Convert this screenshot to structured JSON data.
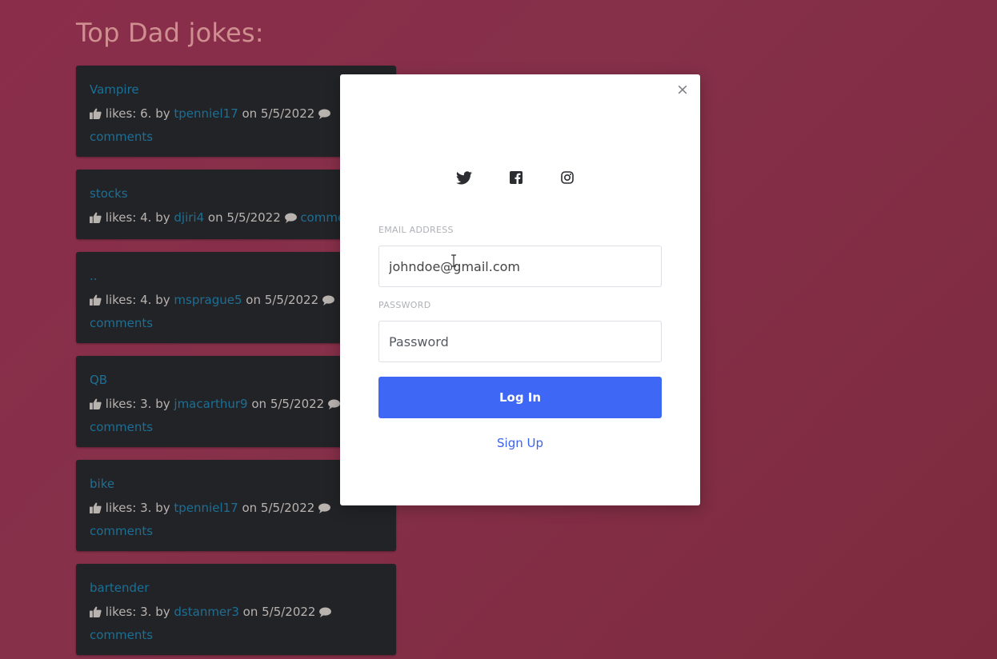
{
  "page": {
    "title": "Top Dad jokes:"
  },
  "jokes": [
    {
      "title": "Vampire",
      "likes_text": "likes: 6. by",
      "author": "tpenniel17",
      "date_text": "on 5/5/2022",
      "comments": "comments"
    },
    {
      "title": "stocks",
      "likes_text": "likes: 4. by",
      "author": "djiri4",
      "date_text": "on 5/5/2022",
      "comments": "comments"
    },
    {
      "title": "..",
      "likes_text": "likes: 4. by",
      "author": "msprague5",
      "date_text": "on 5/5/2022",
      "comments": "comments"
    },
    {
      "title": "QB",
      "likes_text": "likes: 3. by",
      "author": "jmacarthur9",
      "date_text": "on 5/5/2022",
      "comments": "comments"
    },
    {
      "title": "bike",
      "likes_text": "likes: 3. by",
      "author": "tpenniel17",
      "date_text": "on 5/5/2022",
      "comments": "comments"
    },
    {
      "title": "bartender",
      "likes_text": "likes: 3. by",
      "author": "dstanmer3",
      "date_text": "on 5/5/2022",
      "comments": "comments"
    }
  ],
  "modal": {
    "close_glyph": "×",
    "social_icons": [
      "twitter-icon",
      "facebook-icon",
      "instagram-icon"
    ],
    "email_label": "EMAIL ADDRESS",
    "email_value": "johndoe@gmail.com",
    "password_label": "PASSWORD",
    "password_placeholder": "Password",
    "login_label": "Log In",
    "signup_label": "Sign Up",
    "accent_color": "#3f67f6"
  }
}
